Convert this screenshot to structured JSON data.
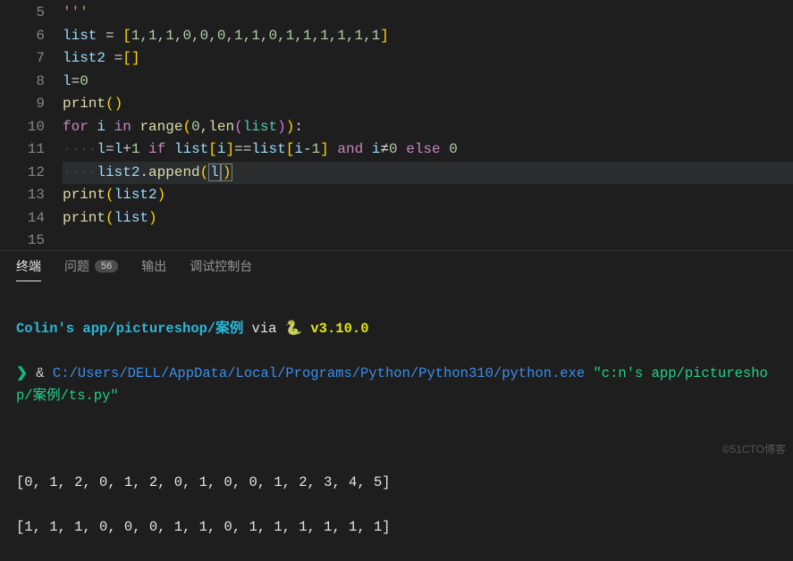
{
  "lineNumbers": [
    "5",
    "6",
    "7",
    "8",
    "9",
    "10",
    "11",
    "12",
    "13",
    "14",
    "15"
  ],
  "code": {
    "l5": "'''",
    "l6_var": "list",
    "l6_eq": " = ",
    "l6_open": "[",
    "l6_vals": "1,1,1,0,0,0,1,1,0,1,1,1,1,1,1",
    "l6_close": "]",
    "l7_var": "list2",
    "l7_eq": " =",
    "l7_open": "[",
    "l7_close": "]",
    "l8_var": "l",
    "l8_eq": "=",
    "l8_val": "0",
    "l9_fn": "print",
    "l9_open": "(",
    "l9_close": ")",
    "l10_for": "for",
    "l10_i": " i ",
    "l10_in": "in",
    "l10_sp": " ",
    "l10_range": "range",
    "l10_open": "(",
    "l10_zero": "0",
    "l10_comma": ",",
    "l10_len": "len",
    "l10_open2": "(",
    "l10_list": "list",
    "l10_close2": ")",
    "l10_close": ")",
    "l10_colon": ":",
    "l11_dots": "····",
    "l11_l": "l",
    "l11_eq": "=",
    "l11_l2": "l",
    "l11_plus": "+",
    "l11_one": "1",
    "l11_sp": " ",
    "l11_if": "if",
    "l11_list": " list",
    "l11_open": "[",
    "l11_i": "i",
    "l11_close": "]",
    "l11_eqeq": "==",
    "l11_list2": "list",
    "l11_open2": "[",
    "l11_i2": "i",
    "l11_minus": "-",
    "l11_one2": "1",
    "l11_close2": "]",
    "l11_and": " and ",
    "l11_i3": "i",
    "l11_ne": "≠",
    "l11_zero": "0",
    "l11_else": " else ",
    "l11_zero2": "0",
    "l12_dots": "····",
    "l12_var": "list2",
    "l12_dot": ".",
    "l12_fn": "append",
    "l12_open": "(",
    "l12_l": "l",
    "l12_close": ")",
    "l13_fn": "print",
    "l13_open": "(",
    "l13_var": "list2",
    "l13_close": ")",
    "l14_fn": "print",
    "l14_open": "(",
    "l14_var": "list",
    "l14_close": ")"
  },
  "tabs": {
    "terminal": "终端",
    "problems": "问题",
    "problemsCount": "56",
    "output": "输出",
    "debug": "调试控制台"
  },
  "terminal": {
    "path": "Colin's app/pictureshop/案例",
    "via": " via ",
    "pybox": "🐍",
    "version": " v3.10.0",
    "prompt": "❯",
    "amp": " & ",
    "exe": "C:/Users/DELL/AppData/Local/Programs/Python/Python310/python.exe",
    "arg": " \"c:n's app/pictureshop/案例/ts.py\"",
    "out1": "[0, 1, 2, 0, 1, 2, 0, 1, 0, 0, 1, 2, 3, 4, 5]",
    "out2": "[1, 1, 1, 0, 0, 0, 1, 1, 0, 1, 1, 1, 1, 1, 1]"
  },
  "watermark": "©51CTO博客"
}
